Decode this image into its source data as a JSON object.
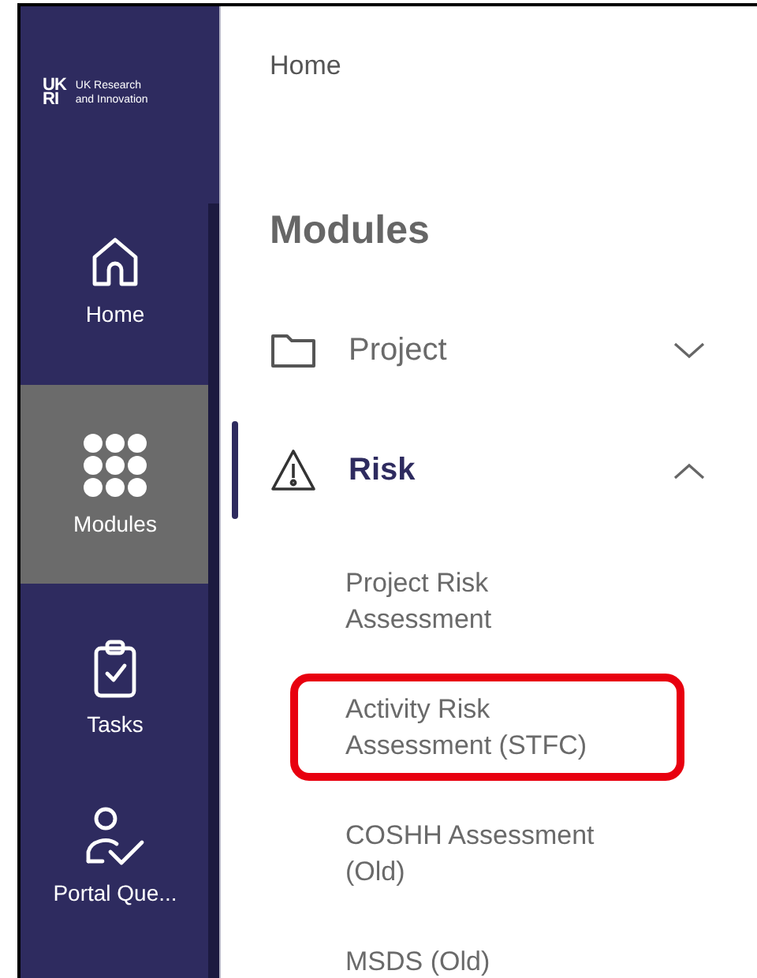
{
  "logo": {
    "mark_lines": [
      "UK",
      "RI"
    ],
    "name_lines": [
      "UK Research",
      "and Innovation"
    ]
  },
  "sidebar": {
    "items": [
      {
        "label": "Home",
        "kind": "home",
        "selected": false
      },
      {
        "label": "Modules",
        "kind": "grid",
        "selected": true
      },
      {
        "label": "Tasks",
        "kind": "clipboard",
        "selected": false
      },
      {
        "label": "Portal Que...",
        "kind": "user-check",
        "selected": false
      }
    ]
  },
  "breadcrumb": "Home",
  "heading": "Modules",
  "modules": [
    {
      "label": "Project",
      "kind": "folder",
      "expanded": false,
      "selected": false
    },
    {
      "label": "Risk",
      "kind": "warning",
      "expanded": true,
      "selected": true,
      "children": [
        {
          "label": "Project Risk Assessment",
          "highlighted": false
        },
        {
          "label": "Activity Risk Assessment (STFC)",
          "highlighted": true
        },
        {
          "label": "COSHH Assessment (Old)",
          "highlighted": false
        },
        {
          "label": "MSDS (Old)",
          "highlighted": false
        }
      ]
    }
  ]
}
